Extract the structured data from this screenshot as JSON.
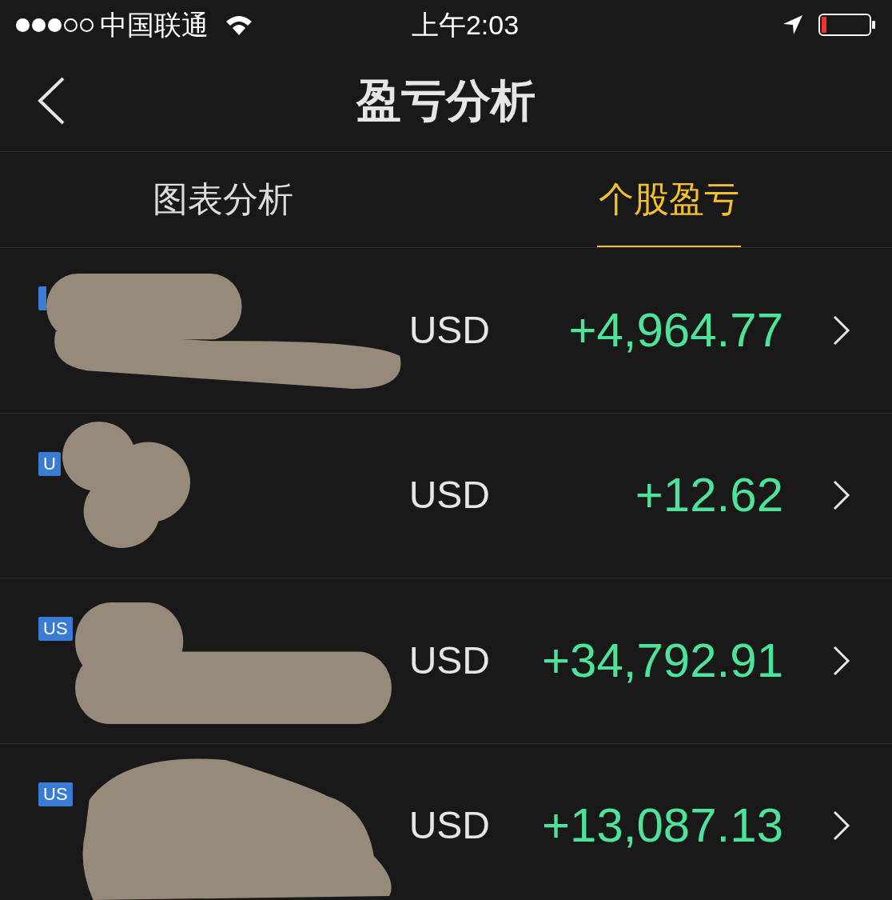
{
  "status_bar": {
    "carrier": "中国联通",
    "time": "上午2:03"
  },
  "nav": {
    "title": "盈亏分析"
  },
  "tabs": [
    {
      "label": "图表分析",
      "selected": false
    },
    {
      "label": "个股盈亏",
      "selected": true
    }
  ],
  "rows": [
    {
      "currency": "USD",
      "amount": "+4,964.77"
    },
    {
      "market": "U",
      "currency": "USD",
      "amount": "+12.62"
    },
    {
      "market": "US",
      "currency": "USD",
      "amount": "+34,792.91"
    },
    {
      "market": "US",
      "currency": "USD",
      "amount": "+13,087.13"
    }
  ]
}
